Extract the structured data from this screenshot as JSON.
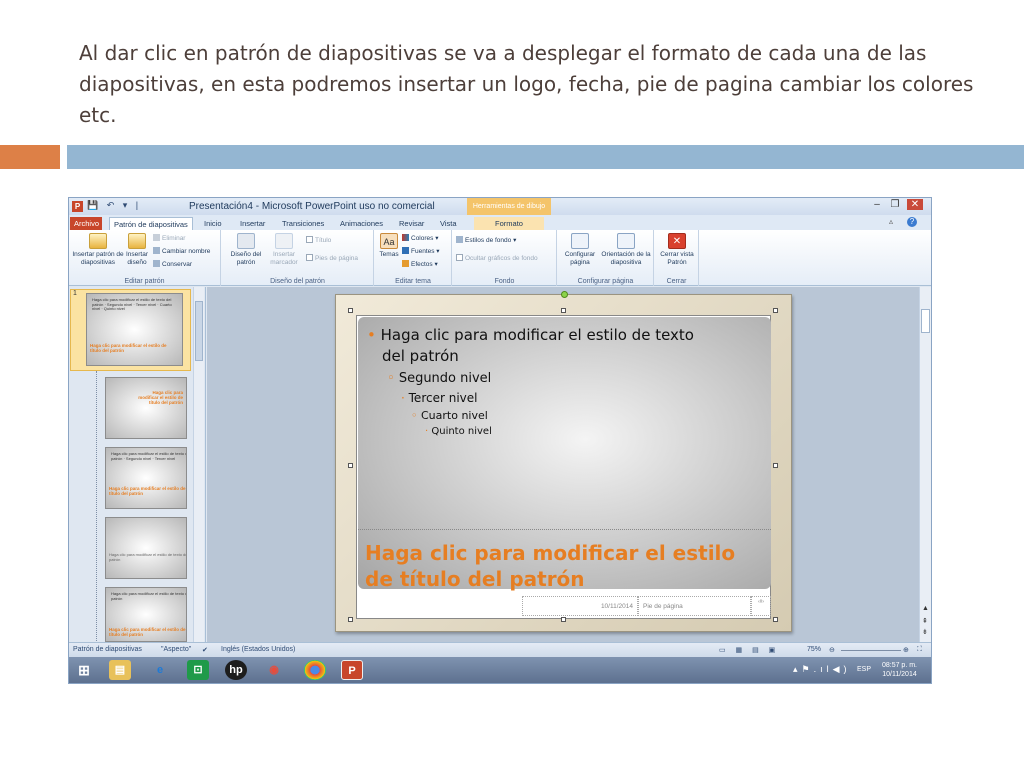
{
  "heading": "Al dar clic en patrón de diapositivas se va a desplegar el formato de cada una de las diapositivas, en esta podremos insertar  un logo, fecha, pie de pagina cambiar los colores etc.",
  "window": {
    "title": "Presentación4 - Microsoft PowerPoint uso no comercial",
    "contextual_tab": "Herramientas de dibujo",
    "app_icon": "P",
    "quick_access": "💾 ↶ ▾ |"
  },
  "tabs": [
    "Archivo",
    "Patrón de diapositivas",
    "Inicio",
    "Insertar",
    "Transiciones",
    "Animaciones",
    "Revisar",
    "Vista",
    "Formato"
  ],
  "ribbon": {
    "editar_patron": {
      "label": "Editar patrón",
      "insert_master": "Insertar patrón de diapositivas",
      "insert_layout": "Insertar diseño",
      "delete": "Eliminar",
      "rename": "Cambiar nombre",
      "preserve": "Conservar"
    },
    "diseno_patron": {
      "label": "Diseño del patrón",
      "master_layout": "Diseño del patrón",
      "insert_placeholder": "Insertar marcador",
      "title_check": "Título",
      "footers_check": "Pies de página"
    },
    "editar_tema": {
      "label": "Editar tema",
      "themes": "Temas",
      "colors": "Colores",
      "fonts": "Fuentes",
      "effects": "Efectos"
    },
    "fondo": {
      "label": "Fondo",
      "bg_styles": "Estilos de fondo",
      "hide_bg": "Ocultar gráficos de fondo"
    },
    "configurar": {
      "label": "Configurar página",
      "page_setup": "Configurar página",
      "orientation": "Orientación de la diapositiva"
    },
    "cerrar": {
      "label": "Cerrar",
      "close_view": "Cerrar vista Patrón"
    }
  },
  "thumbnails": {
    "slide_number": "1",
    "thumb1_text": "Haga clic para modificar el estilo de texto del patrón · Segundo nivel · Tercer nivel · Cuarto nivel · Quinto nivel",
    "thumb1_title": "Haga clic para modificar el estilo de título del patrón",
    "thumb2_title": "Haga clic para modificar el estilo de título del patrón",
    "thumb3_text": "Haga clic para modificar el estilo de texto del patrón · Segundo nivel · Tercer nivel",
    "thumb3_title": "Haga clic para modificar el estilo de título del patrón",
    "thumb4_text": "Haga clic para modificar el estilo de texto del patrón",
    "thumb5_text": "Haga clic para modificar el estilo de texto del patrón",
    "thumb5_title": "Haga clic para modificar el estilo de título del patrón"
  },
  "slide": {
    "level1": "Haga clic para modificar el estilo de texto",
    "level1b": "del patrón",
    "level2": "Segundo nivel",
    "level3": "Tercer nivel",
    "level4": "Cuarto nivel",
    "level5": "Quinto nivel",
    "title": "Haga clic para modificar el estilo de título del patrón",
    "footer_date": "10/11/2014",
    "footer_text": "Pie de página",
    "slide_num": "‹#›"
  },
  "statusbar": {
    "view": "Patrón de diapositivas",
    "theme": "\"Aspecto\"",
    "language": "Inglés (Estados Unidos)",
    "zoom": "75%"
  },
  "taskbar": {
    "lang": "ESP",
    "time": "08:57 p. m.",
    "date": "10/11/2014"
  },
  "colors": {
    "accent_orange": "#dd8047",
    "accent_blue": "#94b6d2",
    "slide_title_orange": "#e67e22"
  }
}
